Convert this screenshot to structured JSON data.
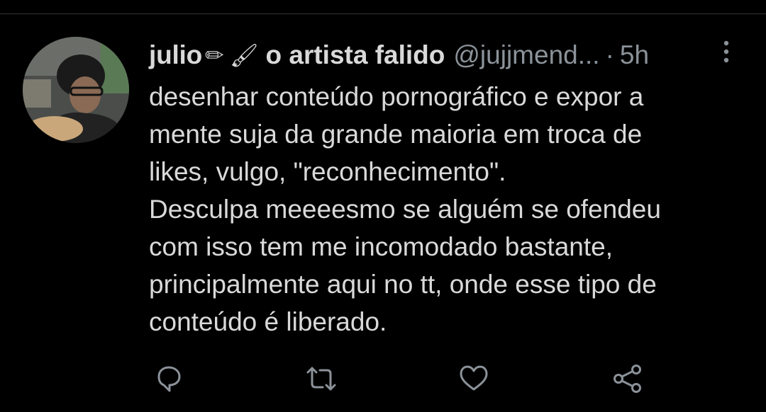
{
  "tweet": {
    "display_name": "julio",
    "name_emoji_1": "✏",
    "name_emoji_2": "🖌",
    "name_tail": "o artista falido",
    "handle": "@jujjmend...",
    "separator": "·",
    "time": "5h",
    "lines": [
      "desenhar conteúdo pornográfico e expor a",
      "mente suja da grande maioria em troca de",
      "likes, vulgo, \"reconhecimento\".",
      "Desculpa meeeesmo se alguém se ofendeu",
      "com isso tem me incomodado bastante,",
      "principalmente aqui no tt, onde esse tipo de",
      "conteúdo é liberado."
    ]
  },
  "icons": {
    "more": "more-vertical-icon",
    "reply": "reply-icon",
    "retweet": "retweet-icon",
    "like": "heart-icon",
    "share": "share-icon"
  },
  "colors": {
    "background": "#000000",
    "text": "#d9d9d9",
    "muted": "#8b9299",
    "divider": "#2f3336"
  }
}
